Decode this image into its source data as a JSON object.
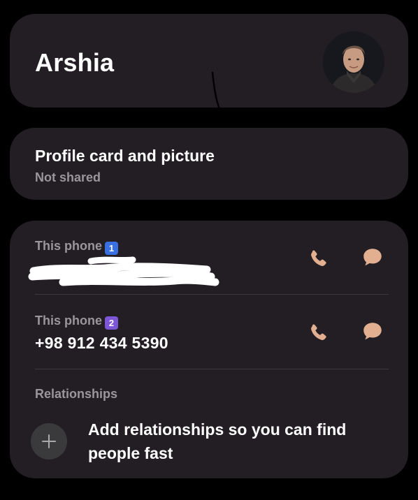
{
  "contact": {
    "name": "Arshia",
    "avatar_icon": "person-photo"
  },
  "profile_card": {
    "title": "Profile card and picture",
    "status": "Not shared"
  },
  "phones": [
    {
      "label": "This phone",
      "sim_badge": "1",
      "badge_color": "#3a6fe0",
      "number": "",
      "number_redacted": true
    },
    {
      "label": "This phone",
      "sim_badge": "2",
      "badge_color": "#7c56d6",
      "number": "+98 912 434 5390",
      "number_redacted": false
    }
  ],
  "relationships": {
    "label": "Relationships",
    "add_text": "Add relationships so you can find people fast"
  },
  "colors": {
    "accent_icon": "#e2b090",
    "card_bg": "#231e24",
    "secondary_text": "#9a969b"
  }
}
